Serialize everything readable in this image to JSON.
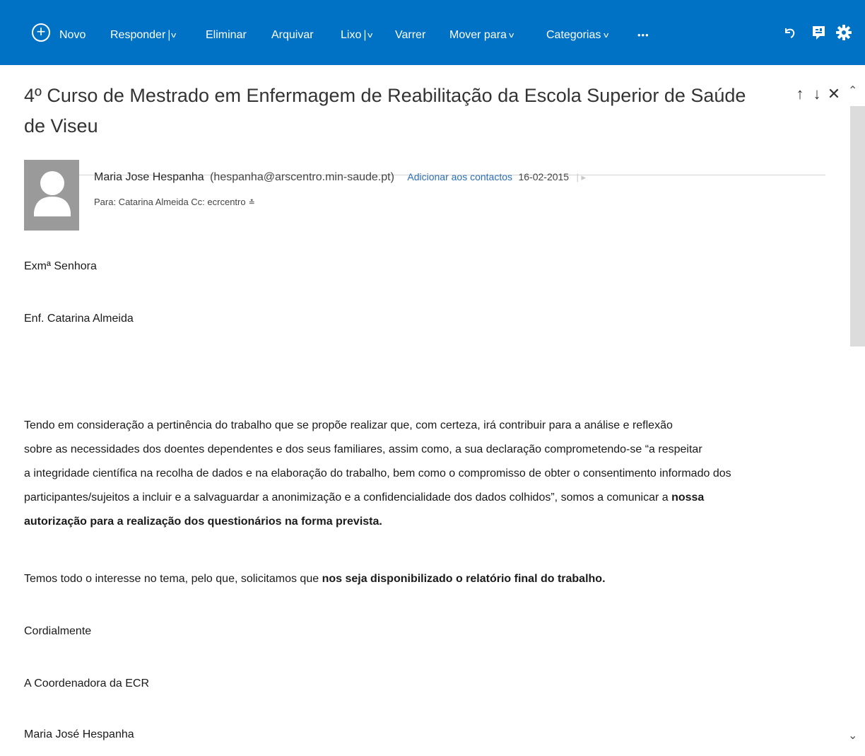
{
  "toolbar": {
    "new_label": "Novo",
    "reply_label": "Responder",
    "delete_label": "Eliminar",
    "archive_label": "Arquivar",
    "junk_label": "Lixo",
    "sweep_label": "Varrer",
    "move_label": "Mover para",
    "categories_label": "Categorias",
    "more_label": "•••",
    "sep": "|",
    "chevron": "v",
    "accent_color": "#0072c6",
    "icons": [
      "plus-circle-icon",
      "undo-icon",
      "feedback-icon",
      "gear-icon"
    ]
  },
  "message": {
    "subject": "4º Curso de Mestrado em Enfermagem de Reabilitação da Escola Superior de Saúde de Viseu",
    "sender_name": "Maria Jose Hespanha",
    "sender_email": "(hespanha@arscentro.min-saude.pt)",
    "add_contact": "Adicionar aos contactos",
    "date": "16-02-2015",
    "recipients": "Para: Catarina Almeida Cc: ecrcentro",
    "nav": {
      "up": "↑",
      "down": "↓",
      "close": "✕"
    }
  },
  "body": {
    "greeting": "Exmª Senhora",
    "addressee": "Enf. Catarina Almeida",
    "para1_l1": "Tendo em consideração a pertinência do trabalho que se propõe realizar que, com certeza, irá contribuir para a análise e reflexão",
    "para1_l2": "sobre as necessidades dos doentes dependentes e dos seus familiares, assim como, a sua declaração comprometendo-se “a respeitar",
    "para1_l3": "a integridade científica na recolha de dados e na elaboração do trabalho, bem como o compromisso de obter o consentimento informado dos",
    "para1_l4": "participantes/sujeitos a incluir e a salvaguardar a anonimização e a confidencialidade dos dados colhidos”, somos a comunicar a ",
    "para1_l4_bold": "nossa",
    "para1_l5_bold": "autorização para a realização dos questionários na forma prevista.",
    "para2": "Temos todo o interesse no tema, pelo que, solicitamos que ",
    "para2_bold": "nos seja disponibilizado o relatório final do trabalho.",
    "closing": "Cordialmente",
    "role": "A Coordenadora da ECR",
    "signature": "Maria José Hespanha"
  }
}
